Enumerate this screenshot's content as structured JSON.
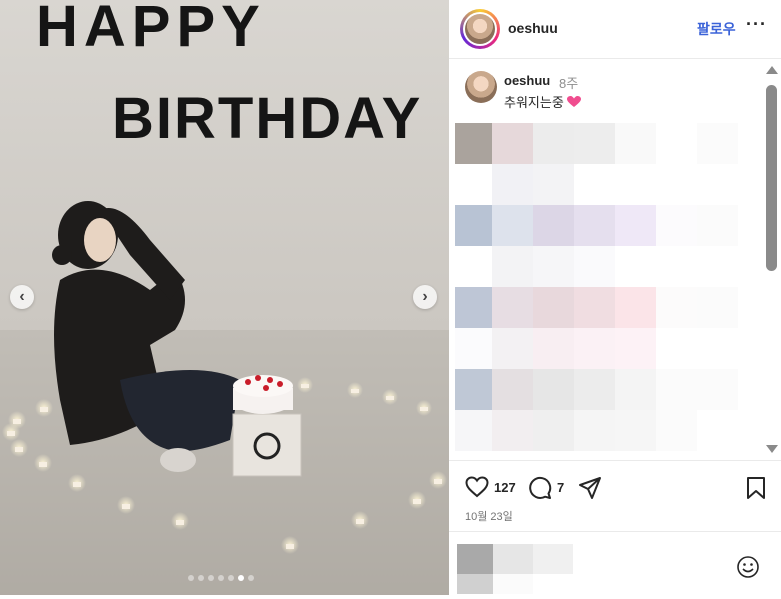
{
  "photo": {
    "nav": {
      "prev_symbol": "‹",
      "next_symbol": "›"
    },
    "carousel": {
      "total": 7,
      "active_index": 5
    }
  },
  "header": {
    "username": "oeshuu",
    "follow_label": "팔로우",
    "more_symbol": "···"
  },
  "caption": {
    "username": "oeshuu",
    "time": "8주",
    "text": "추워지는중"
  },
  "actions": {
    "likes": "127",
    "comments": "7",
    "date": "10월 23일"
  },
  "colors": {
    "follow": "#3b63d8",
    "heart_emoji": "#f04d8f",
    "scrollbar": "#8a8a8a"
  },
  "icons": [
    "chevron-left-icon",
    "chevron-right-icon",
    "heart-icon",
    "comment-icon",
    "share-icon",
    "bookmark-icon",
    "emoji-icon",
    "more-icon"
  ]
}
